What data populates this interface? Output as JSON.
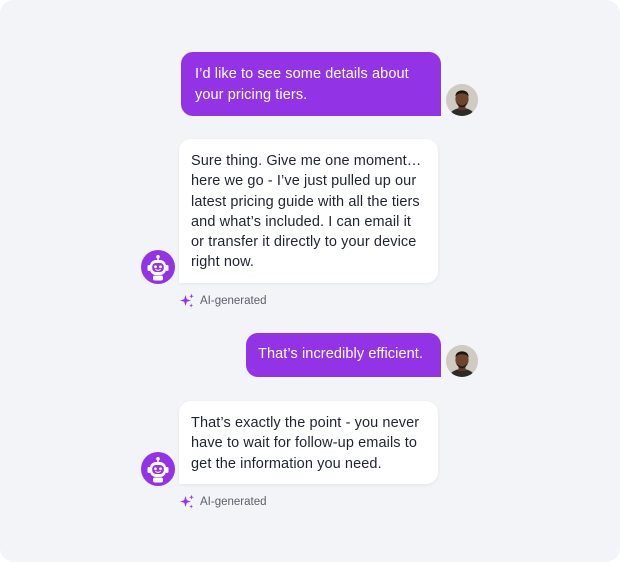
{
  "messages": [
    {
      "role": "user",
      "text": "I’d like to see some details about your pricing tiers."
    },
    {
      "role": "assistant",
      "text": "Sure thing. Give me one moment… here we go - I’ve just pulled up our latest pricing guide with all the tiers and what’s included. I can email it or transfer it directly to your device right now.",
      "label": "AI-generated"
    },
    {
      "role": "user",
      "text": "That’s incredibly efficient."
    },
    {
      "role": "assistant",
      "text": "That’s exactly the point - you never have to wait for follow-up emails to get the information you need.",
      "label": "AI-generated"
    }
  ],
  "icons": {
    "user_avatar": "user-avatar-photo",
    "bot_avatar": "robot-avatar-icon",
    "ai_badge": "sparkle-icon"
  },
  "colors": {
    "panel_background": "#f3f4f7",
    "user_bubble": "#9234e6",
    "user_text": "#ffffff",
    "bot_bubble": "#ffffff",
    "bot_text": "#1f2430",
    "ai_label_text": "#5b5f6b",
    "sparkle": "#9234e6"
  }
}
